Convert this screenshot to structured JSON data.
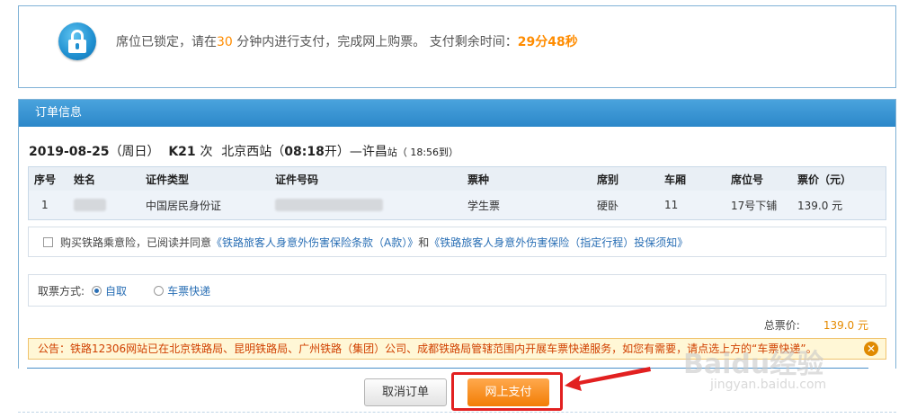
{
  "lock": {
    "msg_a": "席位已锁定，请在",
    "minutes": "30",
    "msg_b": " 分钟内进行支付，完成网上购票。 支付剩余时间：",
    "countdown": "29分48秒"
  },
  "order": {
    "header": "订单信息",
    "date": "2019-08-25",
    "weekday": "（周日）",
    "train": "K21",
    "train_suffix": "次",
    "from": "北京西",
    "from_suffix": "站（",
    "dep_time": "08:18",
    "dep_suffix": "开）—",
    "to": "许昌",
    "to_suffix": "站",
    "arr": "（ 18:56到）"
  },
  "passenger_table": {
    "columns": [
      "序号",
      "姓名",
      "证件类型",
      "证件号码",
      "票种",
      "席别",
      "车厢",
      "席位号",
      "票价（元）"
    ],
    "rows": [
      {
        "no": "1",
        "id_type": "中国居民身份证",
        "ticket_type": "学生票",
        "seat_class": "硬卧",
        "car": "11",
        "seat_no": "17号下铺",
        "price": "139.0 元"
      }
    ]
  },
  "insurance": {
    "prefix": "购买铁路乘意险，已阅读并同意",
    "link1": "《铁路旅客人身意外伤害保险条款（A款）》",
    "and": "和",
    "link2": "《铁路旅客人身意外伤害保险（指定行程）投保须知》"
  },
  "fetch": {
    "label": "取票方式:",
    "option1": "自取",
    "option2": "车票快递"
  },
  "total": {
    "label": "总票价:",
    "value": "139.0 元"
  },
  "notice": {
    "text": "公告：铁路12306网站已在北京铁路局、昆明铁路局、广州铁路（集团）公司、成都铁路局管辖范围内开展车票快递服务，如您有需要，请点选上方的“车票快递”。"
  },
  "buttons": {
    "cancel": "取消订单",
    "pay": "网上支付"
  },
  "watermark": {
    "main": "Baidu经验",
    "sub": "jingyan.baidu.com"
  },
  "colors": {
    "accent_blue": "#2b87c9",
    "highlight_orange": "#ff8c00",
    "annotation_red": "#e22020"
  }
}
